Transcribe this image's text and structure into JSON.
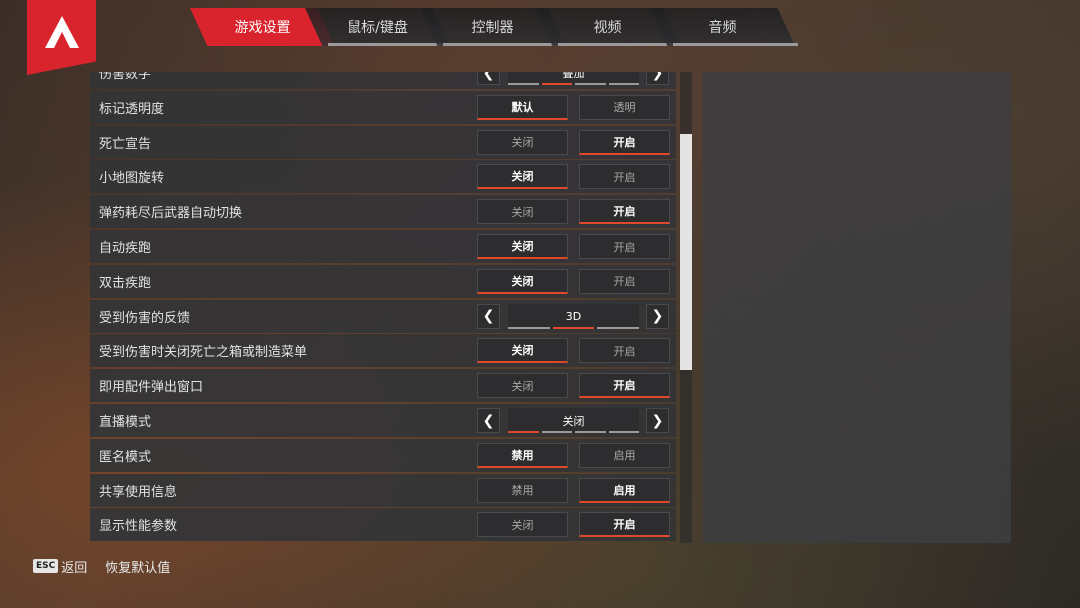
{
  "tabs": [
    {
      "label": "游戏设置",
      "active": true
    },
    {
      "label": "鼠标/键盘",
      "active": false
    },
    {
      "label": "控制器",
      "active": false
    },
    {
      "label": "视频",
      "active": false
    },
    {
      "label": "音频",
      "active": false
    }
  ],
  "settings": [
    {
      "label": "伤害数字",
      "type": "stepper",
      "value": "叠加",
      "level": 2,
      "levels": 4
    },
    {
      "label": "标记透明度",
      "type": "toggle",
      "options": [
        "默认",
        "透明"
      ],
      "selected": 0
    },
    {
      "label": "死亡宣告",
      "type": "toggle",
      "options": [
        "关闭",
        "开启"
      ],
      "selected": 1
    },
    {
      "label": "小地图旋转",
      "type": "toggle",
      "options": [
        "关闭",
        "开启"
      ],
      "selected": 0
    },
    {
      "label": "弹药耗尽后武器自动切换",
      "type": "toggle",
      "options": [
        "关闭",
        "开启"
      ],
      "selected": 1
    },
    {
      "label": "自动疾跑",
      "type": "toggle",
      "options": [
        "关闭",
        "开启"
      ],
      "selected": 0
    },
    {
      "label": "双击疾跑",
      "type": "toggle",
      "options": [
        "关闭",
        "开启"
      ],
      "selected": 0
    },
    {
      "label": "受到伤害的反馈",
      "type": "stepper",
      "value": "3D",
      "level": 2,
      "levels": 3
    },
    {
      "label": "受到伤害时关闭死亡之箱或制造菜单",
      "type": "toggle",
      "options": [
        "关闭",
        "开启"
      ],
      "selected": 0
    },
    {
      "label": "即用配件弹出窗口",
      "type": "toggle",
      "options": [
        "关闭",
        "开启"
      ],
      "selected": 1
    },
    {
      "label": "直播模式",
      "type": "stepper",
      "value": "关闭",
      "level": 1,
      "levels": 4
    },
    {
      "label": "匿名模式",
      "type": "toggle",
      "options": [
        "禁用",
        "启用"
      ],
      "selected": 0
    },
    {
      "label": "共享使用信息",
      "type": "toggle",
      "options": [
        "禁用",
        "启用"
      ],
      "selected": 1
    },
    {
      "label": "显示性能参数",
      "type": "toggle",
      "options": [
        "关闭",
        "开启"
      ],
      "selected": 1
    }
  ],
  "footer": {
    "esc_key": "ESC",
    "back_label": "返回",
    "reset_label": "恢复默认值"
  },
  "colors": {
    "accent": "#d9242d",
    "selected_underline": "#e0482a"
  },
  "icons": {
    "logo": "apex-logo-icon",
    "left": "chevron-left-icon",
    "right": "chevron-right-icon"
  }
}
